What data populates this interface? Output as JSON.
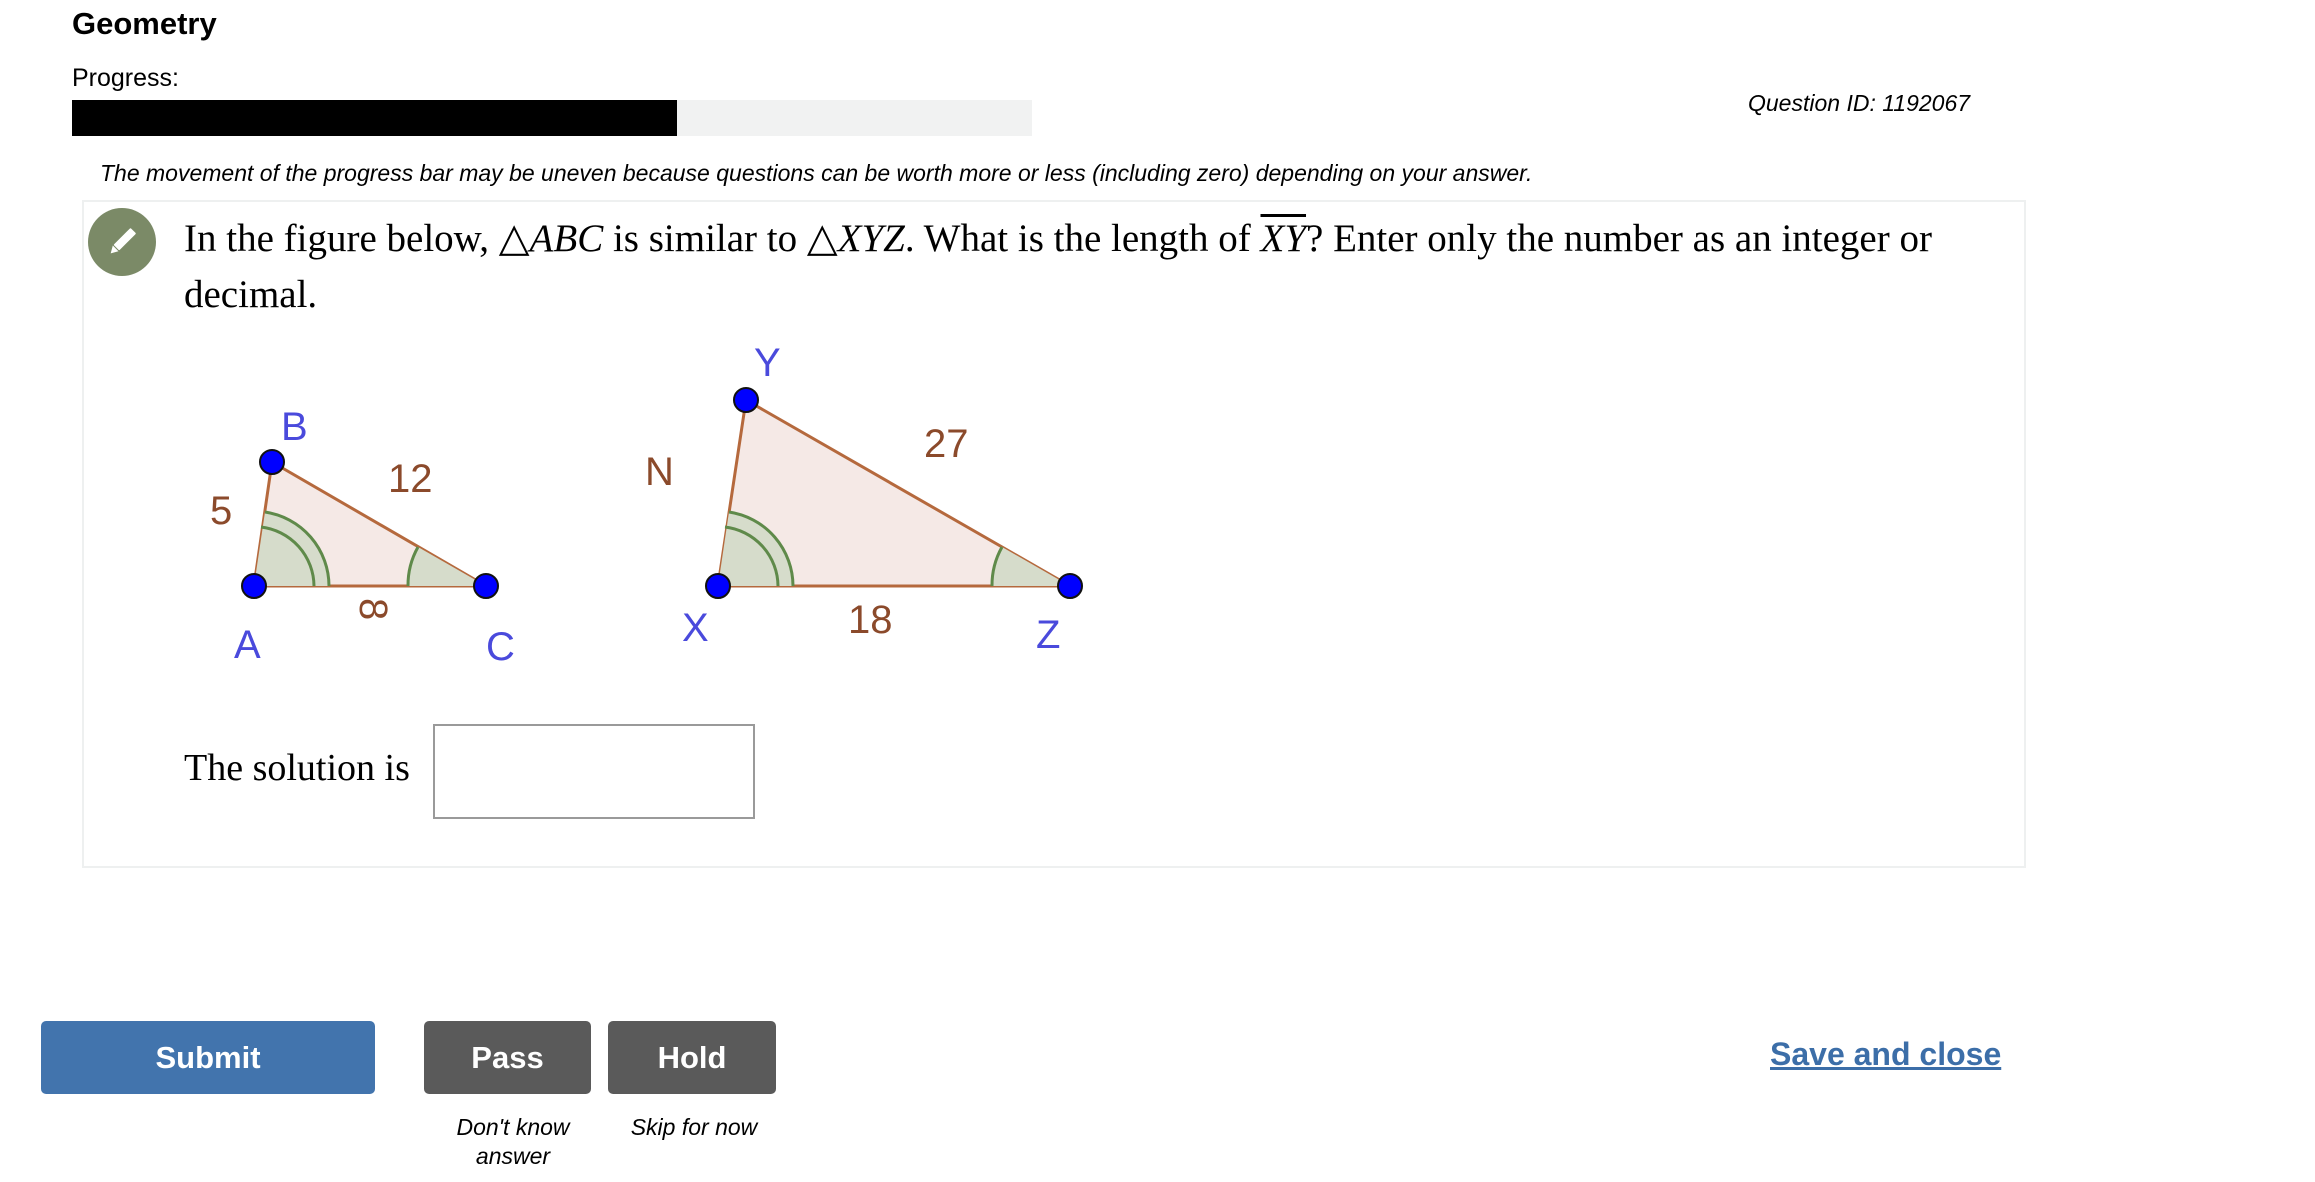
{
  "header": {
    "title": "Geometry",
    "progress_label": "Progress:",
    "progress_fraction": 0.63,
    "question_id": "Question ID: 1192067",
    "progress_note": "The movement of the progress bar may be uneven because questions can be worth more or less (including zero) depending on your answer."
  },
  "question": {
    "text_1": "In the figure below,",
    "tri_symbol": "△",
    "tri_1": "ABC",
    "text_2": "is similar to",
    "tri_2": "XYZ",
    "text_3": ". What is the length of",
    "segment": "XY",
    "text_4": "? Enter only the number as an integer or decimal.",
    "icon": "pencil-icon"
  },
  "figure": {
    "triangle_abc": {
      "vertex_labels": [
        "A",
        "B",
        "C"
      ],
      "side_ab": "5",
      "side_bc": "12",
      "side_ac": "8"
    },
    "triangle_xyz": {
      "vertex_labels": [
        "X",
        "Y",
        "Z"
      ],
      "side_xy": "N",
      "side_yz": "27",
      "side_xz": "18"
    },
    "colors": {
      "vertex": "#0000ff",
      "label": "#4a4adc",
      "side_label": "#8b4a2b",
      "fill": "#f5e9e6",
      "edge": "#b5693d",
      "angle_fill": "#d6dccb",
      "angle_stroke": "#5f8a4a"
    }
  },
  "answer": {
    "label": "The solution is",
    "value": ""
  },
  "actions": {
    "submit": "Submit",
    "pass": "Pass",
    "hold": "Hold",
    "pass_hint": "Don't know answer",
    "hold_hint": "Skip for now",
    "save_close": "Save and close"
  },
  "colors": {
    "submit_bg": "#4274ad",
    "secondary_bg": "#5a5a5a",
    "link": "#3c6ea8",
    "progress_fill": "#000000",
    "progress_track": "#f1f2f2"
  }
}
